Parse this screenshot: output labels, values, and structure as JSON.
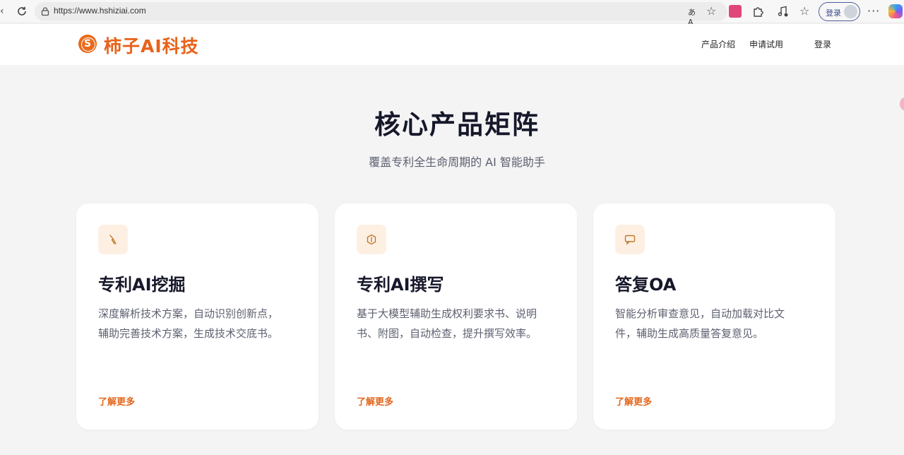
{
  "browser": {
    "url": "https://www.hshiziai.com",
    "login_label": "登录",
    "translate_glyph": "あA"
  },
  "header": {
    "logo_glyph": "S",
    "logo_text": "柿子AI科技",
    "nav": [
      "产品介绍",
      "申请试用",
      "登录"
    ]
  },
  "section": {
    "title": "核心产品矩阵",
    "subtitle": "覆盖专利全生命周期的 AI 智能助手"
  },
  "cards": [
    {
      "icon": "pickaxe-icon",
      "title": "专利AI挖掘",
      "desc_lines": [
        "深度解析技术方案，自动识别创新点，",
        "辅助完善技术方案，生成技术交底书。"
      ],
      "link": "了解更多"
    },
    {
      "icon": "hexagon-icon",
      "title": "专利AI撰写",
      "desc_lines": [
        "基于大模型辅助生成权利要求书、说明",
        "书、附图，自动检查，提升撰写效率。"
      ],
      "link": "了解更多"
    },
    {
      "icon": "chat-bubble-icon",
      "title": "答复OA",
      "desc_lines": [
        "智能分析审查意见，自动加载对比文",
        "件，辅助生成高质量答复意见。"
      ],
      "link": "了解更多"
    }
  ],
  "colors": {
    "accent": "#e8621a",
    "title": "#16182a",
    "text": "#5d6070",
    "icon_bg": "#fdf0e3"
  }
}
